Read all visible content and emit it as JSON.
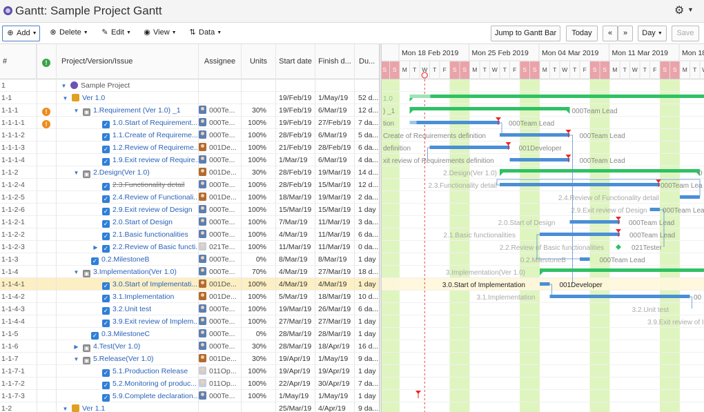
{
  "window": {
    "title": "Gantt:  Sample Project Gantt"
  },
  "toolbar": {
    "add": "Add",
    "delete": "Delete",
    "edit": "Edit",
    "view": "View",
    "data": "Data",
    "jump": "Jump to Gantt Bar",
    "today": "Today",
    "prev": "«",
    "next": "»",
    "scale": "Day",
    "save": "Save"
  },
  "columns": {
    "num": "#",
    "name": "Project/Version/Issue",
    "assignee": "Assignee",
    "units": "Units",
    "start": "Start date",
    "finish": "Finish d...",
    "duration": "Du..."
  },
  "timeline": {
    "weeks": [
      "Mon 18 Feb 2019",
      "Mon 25 Feb 2019",
      "Mon 04 Mar 2019",
      "Mon 11 Mar 2019",
      "Mon 18"
    ],
    "day_letters": [
      "S",
      "S",
      "M",
      "T",
      "W",
      "T",
      "F",
      "S",
      "S",
      "M",
      "T",
      "W",
      "T",
      "F",
      "S",
      "S",
      "M",
      "T",
      "W",
      "T",
      "F",
      "S",
      "S",
      "M",
      "T",
      "W",
      "T",
      "F",
      "S",
      "S",
      "M",
      "T",
      "W"
    ]
  },
  "rows": [
    {
      "num": "1",
      "name": "Sample Project",
      "type": "project",
      "assignee": "",
      "units": "",
      "start": "",
      "finish": "",
      "dur": ""
    },
    {
      "num": "1-1",
      "name": "Ver 1.0",
      "type": "version",
      "assignee": "",
      "units": "",
      "start": "19/Feb/19",
      "finish": "1/May/19",
      "dur": "52 d..."
    },
    {
      "num": "1-1-1",
      "name": "1.Requirement (Ver 1.0) _1",
      "type": "group",
      "warn": "orange",
      "assignee": "000Te...",
      "units": "30%",
      "start": "19/Feb/19",
      "finish": "6/Mar/19",
      "dur": "12 d..."
    },
    {
      "num": "1-1-1-1",
      "name": "1.0.Start of Requirement...",
      "type": "task",
      "warn": "orange",
      "assignee": "000Te...",
      "units": "100%",
      "start": "19/Feb/19",
      "finish": "27/Feb/19",
      "dur": "7 da..."
    },
    {
      "num": "1-1-1-2",
      "name": "1.1.Create of Requireme...",
      "type": "task",
      "assignee": "000Te...",
      "units": "100%",
      "start": "28/Feb/19",
      "finish": "6/Mar/19",
      "dur": "5 da..."
    },
    {
      "num": "1-1-1-3",
      "name": "1.2.Review of Requireme...",
      "type": "task",
      "assignee": "001De...",
      "units": "100%",
      "start": "21/Feb/19",
      "finish": "28/Feb/19",
      "dur": "6 da..."
    },
    {
      "num": "1-1-1-4",
      "name": "1.9.Exit review of Require...",
      "type": "task",
      "assignee": "000Te...",
      "units": "100%",
      "start": "1/Mar/19",
      "finish": "6/Mar/19",
      "dur": "4 da..."
    },
    {
      "num": "1-1-2",
      "name": "2.Design(Ver 1.0)",
      "type": "group",
      "assignee": "001De...",
      "units": "30%",
      "start": "28/Feb/19",
      "finish": "19/Mar/19",
      "dur": "14 d..."
    },
    {
      "num": "1-1-2-4",
      "name": "2.3.Functionality detail",
      "type": "task",
      "strike": true,
      "assignee": "000Te...",
      "units": "100%",
      "start": "28/Feb/19",
      "finish": "15/Mar/19",
      "dur": "12 d..."
    },
    {
      "num": "1-1-2-5",
      "name": "2.4.Review of Functionali...",
      "type": "task",
      "assignee": "001De...",
      "units": "100%",
      "start": "18/Mar/19",
      "finish": "19/Mar/19",
      "dur": "2 da..."
    },
    {
      "num": "1-1-2-6",
      "name": "2.9.Exit review of Design",
      "type": "task",
      "assignee": "000Te...",
      "units": "100%",
      "start": "15/Mar/19",
      "finish": "15/Mar/19",
      "dur": "1 day"
    },
    {
      "num": "1-1-2-1",
      "name": "2.0.Start of Design",
      "type": "task",
      "assignee": "000Te...",
      "units": "100%",
      "start": "7/Mar/19",
      "finish": "11/Mar/19",
      "dur": "3 da..."
    },
    {
      "num": "1-1-2-2",
      "name": "2.1.Basic functionalities",
      "type": "task",
      "assignee": "000Te...",
      "units": "100%",
      "start": "4/Mar/19",
      "finish": "11/Mar/19",
      "dur": "6 da..."
    },
    {
      "num": "1-1-2-3",
      "name": "2.2.Review of Basic functi...",
      "type": "task",
      "collapsed": true,
      "assignee": "021Te...",
      "units": "100%",
      "start": "11/Mar/19",
      "finish": "11/Mar/19",
      "dur": "0 da..."
    },
    {
      "num": "1-1-3",
      "name": "0.2.MilestoneB",
      "type": "task",
      "assignee": "000Te...",
      "units": "0%",
      "start": "8/Mar/19",
      "finish": "8/Mar/19",
      "dur": "1 day"
    },
    {
      "num": "1-1-4",
      "name": "3.Implementation(Ver 1.0)",
      "type": "group",
      "assignee": "000Te...",
      "units": "70%",
      "start": "4/Mar/19",
      "finish": "27/Mar/19",
      "dur": "18 d..."
    },
    {
      "num": "1-1-4-1",
      "name": "3.0.Start of Implementati...",
      "type": "task",
      "sel": true,
      "assignee": "001De...",
      "units": "100%",
      "start": "4/Mar/19",
      "finish": "4/Mar/19",
      "dur": "1 day"
    },
    {
      "num": "1-1-4-2",
      "name": "3.1.Implementation",
      "type": "task",
      "assignee": "001De...",
      "units": "100%",
      "start": "5/Mar/19",
      "finish": "18/Mar/19",
      "dur": "10 d..."
    },
    {
      "num": "1-1-4-3",
      "name": "3.2.Unit test",
      "type": "task",
      "assignee": "000Te...",
      "units": "100%",
      "start": "19/Mar/19",
      "finish": "26/Mar/19",
      "dur": "6 da..."
    },
    {
      "num": "1-1-4-4",
      "name": "3.9.Exit review of Implem...",
      "type": "task",
      "assignee": "000Te...",
      "units": "100%",
      "start": "27/Mar/19",
      "finish": "27/Mar/19",
      "dur": "1 day"
    },
    {
      "num": "1-1-5",
      "name": "0.3.MilestoneC",
      "type": "task",
      "assignee": "000Te...",
      "units": "0%",
      "start": "28/Mar/19",
      "finish": "28/Mar/19",
      "dur": "1 day"
    },
    {
      "num": "1-1-6",
      "name": "4.Test(Ver 1.0)",
      "type": "group",
      "collapsed": true,
      "assignee": "000Te...",
      "units": "30%",
      "start": "28/Mar/19",
      "finish": "18/Apr/19",
      "dur": "16 d..."
    },
    {
      "num": "1-1-7",
      "name": "5.Release(Ver 1.0)",
      "type": "group",
      "assignee": "001De...",
      "units": "30%",
      "start": "19/Apr/19",
      "finish": "1/May/19",
      "dur": "9 da..."
    },
    {
      "num": "1-1-7-1",
      "name": "5.1.Production Release",
      "type": "task",
      "assignee": "011Op...",
      "units": "100%",
      "start": "19/Apr/19",
      "finish": "19/Apr/19",
      "dur": "1 day"
    },
    {
      "num": "1-1-7-2",
      "name": "5.2.Monitoring of produc...",
      "type": "task",
      "assignee": "011Op...",
      "units": "100%",
      "start": "22/Apr/19",
      "finish": "30/Apr/19",
      "dur": "7 da..."
    },
    {
      "num": "1-1-7-3",
      "name": "5.9.Complete declaration...",
      "type": "task",
      "assignee": "000Te...",
      "units": "100%",
      "start": "1/May/19",
      "finish": "1/May/19",
      "dur": "1 day"
    },
    {
      "num": "1-2",
      "name": "Ver 1.1",
      "type": "version",
      "assignee": "",
      "units": "",
      "start": "25/Mar/19",
      "finish": "4/Apr/19",
      "dur": "9 da..."
    }
  ],
  "gantt_labels": {
    "ver10_left": "1.0",
    "req_left": ") _1",
    "req_right": "000Team Lead",
    "t100_left": "tion",
    "t100_right": "000Team Lead",
    "t11_left": "Create of Requirements definition",
    "t11_right": "000Team Lead",
    "t12_left": "definition",
    "t12_right": "001Developer",
    "t19_left": "xit review of Requirements definition",
    "t19_right": "000Team Lead",
    "design_left": "2.Design(Ver 1.0)",
    "design_right": "0",
    "t23_left": "2.3.Functionality detail",
    "t23_right": "000Team Lea",
    "t24_left": "2.4.Review of Functionality detail",
    "t29_left": "2.9.Exit review of Design",
    "t29_right": "000Team Lead",
    "t20_left": "2.0.Start of Design",
    "t20_right": "000Team Lead",
    "t21_left": "2.1.Basic functionalities",
    "t21_right": "000Team Lead",
    "t22_left": "2.2.Review of Basic functionalities",
    "t22_right": "021Tester",
    "mb_left": "0.2.MilestoneB",
    "mb_right": "000Team Lead",
    "impl_left": "3.Implementation(Ver 1.0)",
    "t30_left": "3.0.Start of Implementation",
    "t30_right": "001Developer",
    "t31_left": "3.1.Implementation",
    "t31_right": "00",
    "t32_left": "3.2.Unit test",
    "t39_left": "3.9.Exit review of I"
  },
  "colors": {
    "accent": "#3a78c8",
    "bar": "#4a8fd6",
    "summary": "#2fc164",
    "weekend": "#dff5c0",
    "weekend_hdr": "#eaa3a9"
  }
}
